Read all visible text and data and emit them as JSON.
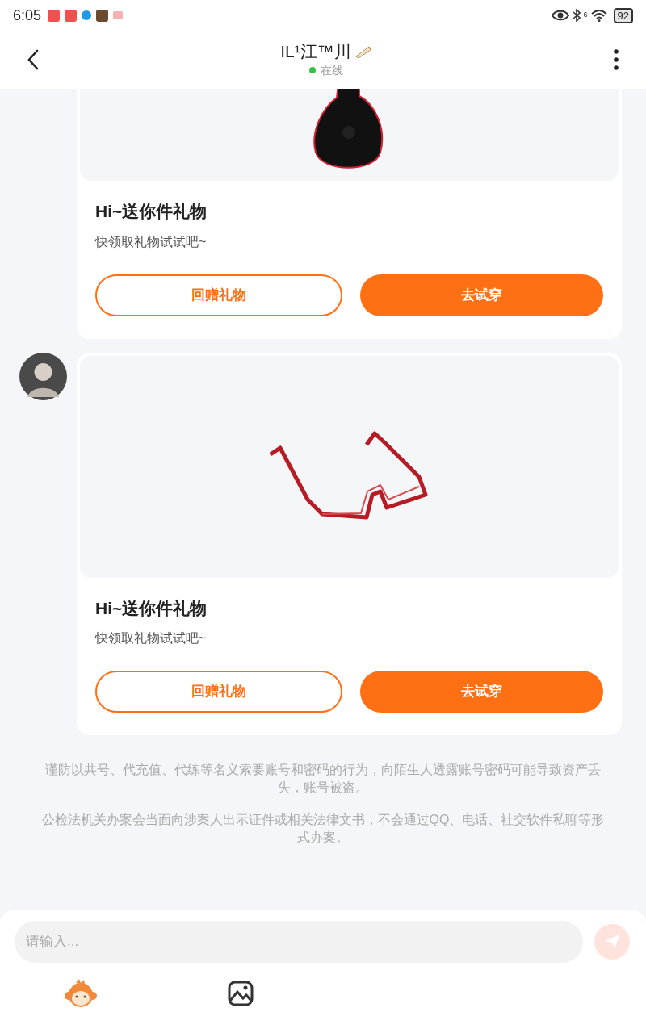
{
  "status_bar": {
    "time": "6:05",
    "network_label": "6",
    "battery": "92"
  },
  "header": {
    "title": "IL¹江™川",
    "presence": "在线",
    "online": true
  },
  "messages": [
    {
      "title": "Hi~送你件礼物",
      "subtitle": "快领取礼物试试吧~",
      "secondary_button": "回赠礼物",
      "primary_button": "去试穿"
    },
    {
      "show_avatar": true,
      "title": "Hi~送你件礼物",
      "subtitle": "快领取礼物试试吧~",
      "secondary_button": "回赠礼物",
      "primary_button": "去试穿"
    }
  ],
  "notices": [
    "谨防以共号、代充值、代练等名义索要账号和密码的行为，向陌生人透露账号密码可能导致资产丢失，账号被盗。",
    "公检法机关办案会当面向涉案人出示证件或相关法律文书，不会通过QQ、电话、社交软件私聊等形式办案。"
  ],
  "input": {
    "placeholder": "请输入..."
  }
}
